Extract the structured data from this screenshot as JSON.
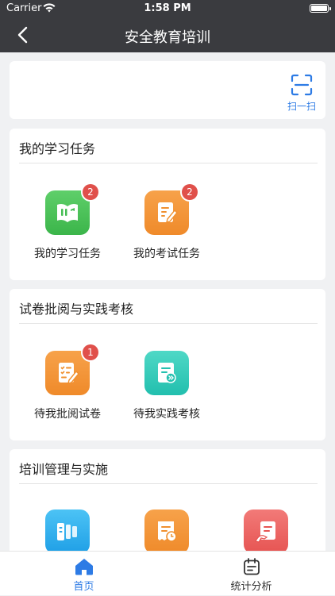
{
  "status_bar": {
    "carrier": "Carrier",
    "time": "1:58 PM"
  },
  "nav": {
    "title": "安全教育培训"
  },
  "scan": {
    "label": "扫一扫"
  },
  "sections": [
    {
      "title": "我的学习任务",
      "items": [
        {
          "label": "我的学习任务",
          "badge": "2",
          "icon": "book-icon",
          "color": "#4cc35a"
        },
        {
          "label": "我的考试任务",
          "badge": "2",
          "icon": "exam-paper-pen-icon",
          "color": "#f2923a"
        }
      ]
    },
    {
      "title": "试卷批阅与实践考核",
      "items": [
        {
          "label": "待我批阅试卷",
          "badge": "1",
          "icon": "checklist-pen-icon",
          "color": "#f2923a"
        },
        {
          "label": "待我实践考核",
          "icon": "document-arrow-icon",
          "color": "#2fc9b6"
        }
      ]
    },
    {
      "title": "培训管理与实施",
      "items": [
        {
          "icon": "columns-icon",
          "color": "#2aa9ea"
        },
        {
          "icon": "receipt-clock-icon",
          "color": "#f2923a"
        },
        {
          "icon": "document-hand-icon",
          "color": "#ea5e5c"
        }
      ]
    }
  ],
  "tabs": [
    {
      "label": "首页",
      "icon": "home-icon",
      "active": true,
      "color": "#2d7be5"
    },
    {
      "label": "统计分析",
      "icon": "calendar-list-icon",
      "active": false
    }
  ]
}
